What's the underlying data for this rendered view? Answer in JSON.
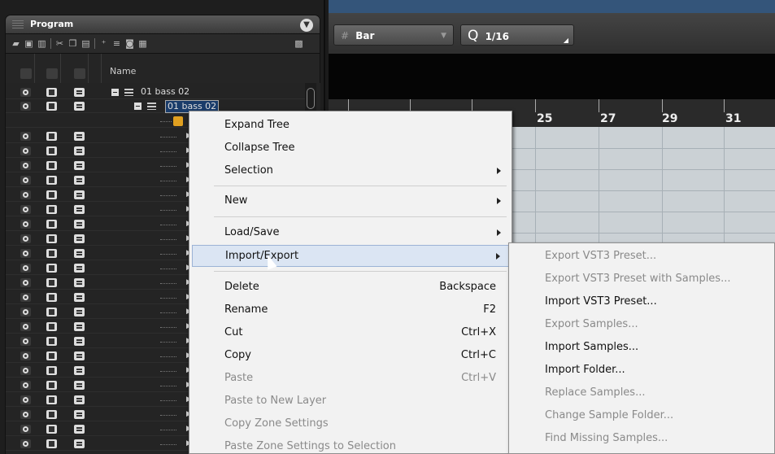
{
  "panel": {
    "title": "Program",
    "header_name": "Name",
    "tree": {
      "program": "01 bass 02",
      "layer": "01 bass 02"
    }
  },
  "toolbar2": {
    "grid_type": "Bar",
    "quantize": "1/16"
  },
  "ruler": {
    "bars": [
      "25",
      "27",
      "29",
      "31"
    ]
  },
  "context_menu": {
    "items": [
      {
        "label": "Expand Tree",
        "shortcut": "",
        "submenu": false,
        "disabled": false
      },
      {
        "label": "Collapse Tree",
        "shortcut": "",
        "submenu": false,
        "disabled": false
      },
      {
        "label": "Selection",
        "shortcut": "",
        "submenu": true,
        "disabled": false
      },
      {
        "label": "New",
        "shortcut": "",
        "submenu": true,
        "disabled": false
      },
      {
        "label": "Load/Save",
        "shortcut": "",
        "submenu": true,
        "disabled": false
      },
      {
        "label": "Import/Export",
        "shortcut": "",
        "submenu": true,
        "disabled": false,
        "highlighted": true
      },
      {
        "label": "Delete",
        "shortcut": "Backspace",
        "submenu": false,
        "disabled": false
      },
      {
        "label": "Rename",
        "shortcut": "F2",
        "submenu": false,
        "disabled": false
      },
      {
        "label": "Cut",
        "shortcut": "Ctrl+X",
        "submenu": false,
        "disabled": false
      },
      {
        "label": "Copy",
        "shortcut": "Ctrl+C",
        "submenu": false,
        "disabled": false
      },
      {
        "label": "Paste",
        "shortcut": "Ctrl+V",
        "submenu": false,
        "disabled": true
      },
      {
        "label": "Paste to New Layer",
        "shortcut": "",
        "submenu": false,
        "disabled": true
      },
      {
        "label": "Copy Zone Settings",
        "shortcut": "",
        "submenu": false,
        "disabled": true
      },
      {
        "label": "Paste Zone Settings to Selection",
        "shortcut": "",
        "submenu": false,
        "disabled": true
      }
    ]
  },
  "submenu": {
    "items": [
      {
        "label": "Export VST3 Preset...",
        "disabled": true
      },
      {
        "label": "Export VST3 Preset with Samples...",
        "disabled": true
      },
      {
        "label": "Import VST3 Preset...",
        "disabled": false
      },
      {
        "label": "Export Samples...",
        "disabled": true
      },
      {
        "label": "Import Samples...",
        "disabled": false
      },
      {
        "label": "Import Folder...",
        "disabled": false
      },
      {
        "label": "Replace Samples...",
        "disabled": true
      },
      {
        "label": "Change Sample Folder...",
        "disabled": true
      },
      {
        "label": "Find Missing Samples...",
        "disabled": true
      }
    ]
  },
  "colors": {
    "menu_bg": "#f2f2f2",
    "highlight": "#dbe5f3",
    "grid_bg": "#cbd1d5"
  }
}
